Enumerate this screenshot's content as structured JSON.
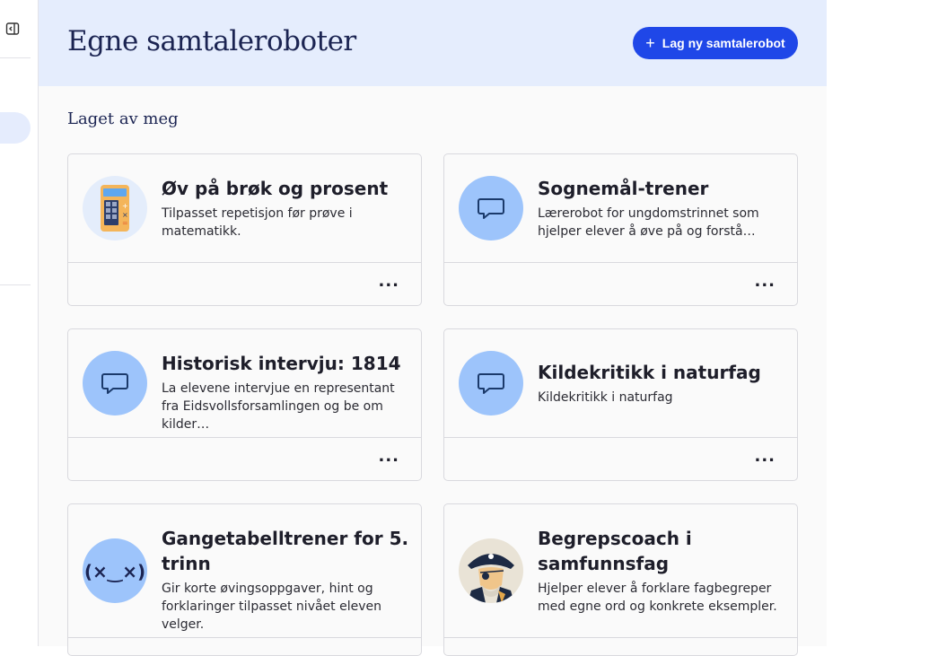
{
  "header": {
    "title": "Egne samtaleroboter",
    "new_button_label": "Lag ny samtalerobot"
  },
  "section": {
    "title": "Laget av meg"
  },
  "cards": [
    {
      "title": "Øv på brøk og prosent",
      "description": "Tilpasset repetisjon før prøve i matematikk.",
      "icon": "calculator-icon",
      "menu": "..."
    },
    {
      "title": "Sognemål-trener",
      "description": "Lærerobot for ungdomstrinnet som hjelper elever å øve på og forstå…",
      "icon": "chat-bubble-icon",
      "menu": "..."
    },
    {
      "title": "Historisk intervju: 1814",
      "description": "La elevene intervjue en representant fra Eidsvollsforsamlingen og be om kilder…",
      "icon": "chat-bubble-icon",
      "menu": "..."
    },
    {
      "title": "Kildekritikk i naturfag",
      "description": "Kildekritikk i naturfag",
      "icon": "chat-bubble-icon",
      "menu": "..."
    },
    {
      "title": "Gangetabelltrener for 5. trinn",
      "description": "Gir korte øvingsoppgaver, hint og forklaringer tilpasset nivået eleven velger.",
      "icon": "emoticon-face-icon",
      "menu": "..."
    },
    {
      "title": "Begrepscoach i samfunnsfag",
      "description": "Hjelper elever å forklare fagbegreper med egne ord og konkrete eksempler.",
      "icon": "pirate-captain-icon",
      "menu": "..."
    }
  ],
  "colors": {
    "accent": "#1f47e8",
    "header_bg": "#e5edfd",
    "avatar_bg": "#9dc4fb",
    "title_text": "#1b2452"
  }
}
